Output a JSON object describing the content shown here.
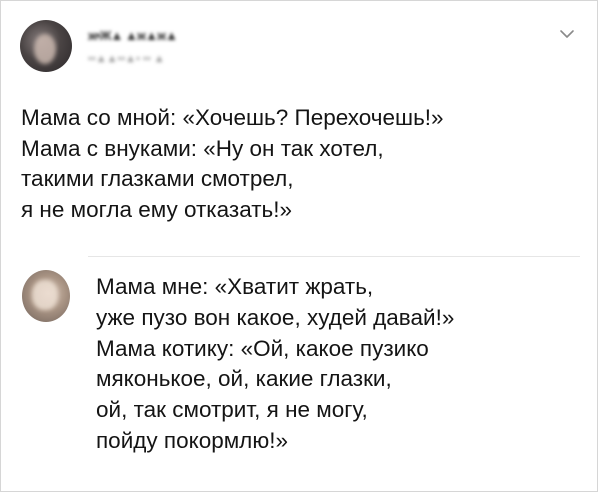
{
  "tweet": {
    "author_name": "ж•Ж▲ ▲ж▲ж▲",
    "author_handle": "••▲▲••▲• •• ▲",
    "lines": [
      "Мама со мной: «Хочешь? Перехочешь!»",
      "Мама с внуками: «Ну он так хотел,",
      "такими глазками смотрел,",
      "я не могла ему отказать!»"
    ],
    "menu_icon": "chevron-down-icon"
  },
  "reply": {
    "lines": [
      "Мама мне: «Хватит жрать,",
      "уже пузо вон какое, худей давай!»",
      "Мама котику: «Ой, какое пузико",
      "мяконькое, ой, какие глазки,",
      "ой, так смотрит, я не могу,",
      "пойду покормлю!»"
    ]
  },
  "colors": {
    "text": "#141414",
    "divider": "#e6e6e6",
    "border": "#d6d6d6",
    "chevron": "#8a8a8a"
  }
}
